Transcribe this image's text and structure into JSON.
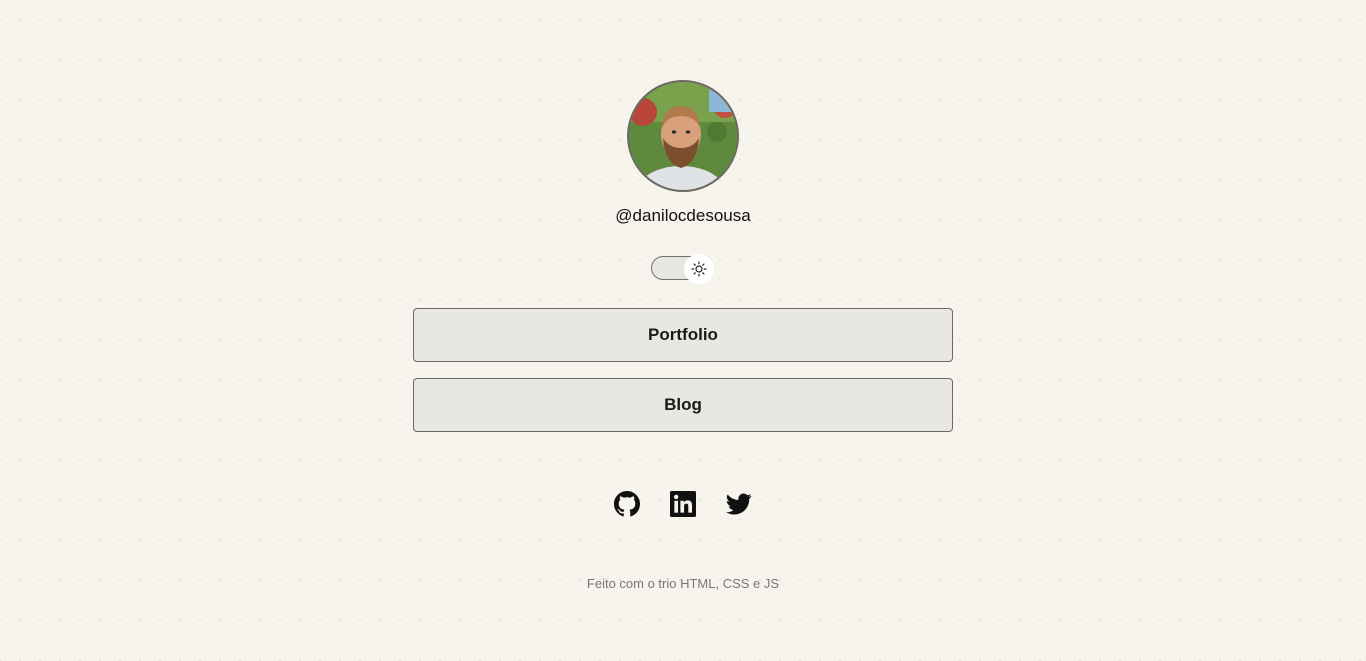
{
  "profile": {
    "username": "@danilocdesousa",
    "avatar_alt": "danilocdesousa"
  },
  "theme_toggle": {
    "state": "light",
    "icon": "sun-icon"
  },
  "links": [
    {
      "label": "Portfolio"
    },
    {
      "label": "Blog"
    }
  ],
  "social": [
    {
      "name": "GitHub",
      "icon": "github-icon"
    },
    {
      "name": "LinkedIn",
      "icon": "linkedin-icon"
    },
    {
      "name": "Twitter",
      "icon": "twitter-icon"
    }
  ],
  "footer": {
    "text": "Feito com o trio HTML, CSS e JS"
  },
  "colors": {
    "background": "#f6f4ed",
    "button_bg": "#e9e7e1",
    "button_border": "#6a6a6a",
    "text": "#1a1a1a",
    "footer_text": "#777777"
  }
}
